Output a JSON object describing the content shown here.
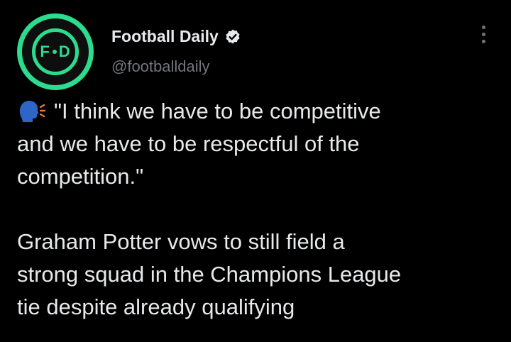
{
  "tweet": {
    "author": {
      "display_name": "Football Daily",
      "handle": "@footballdaily",
      "avatar_letters": {
        "left": "F",
        "right": "D"
      },
      "verified": true
    },
    "icons": {
      "speaking_head": "speaking-head-icon",
      "verified": "verified-badge-icon",
      "more": "more-options-icon"
    },
    "quote_lines": [
      "\"I think we have to be competitive",
      "and we have to be respectful of the",
      "competition.\""
    ],
    "body_lines": [
      "Graham Potter vows to still field a",
      "strong squad in the Champions League",
      "tie despite already qualifying"
    ]
  },
  "colors": {
    "background": "#000000",
    "text_primary": "#e7e9ea",
    "text_secondary": "#71767b",
    "brand_green": "#2bdc8f"
  }
}
